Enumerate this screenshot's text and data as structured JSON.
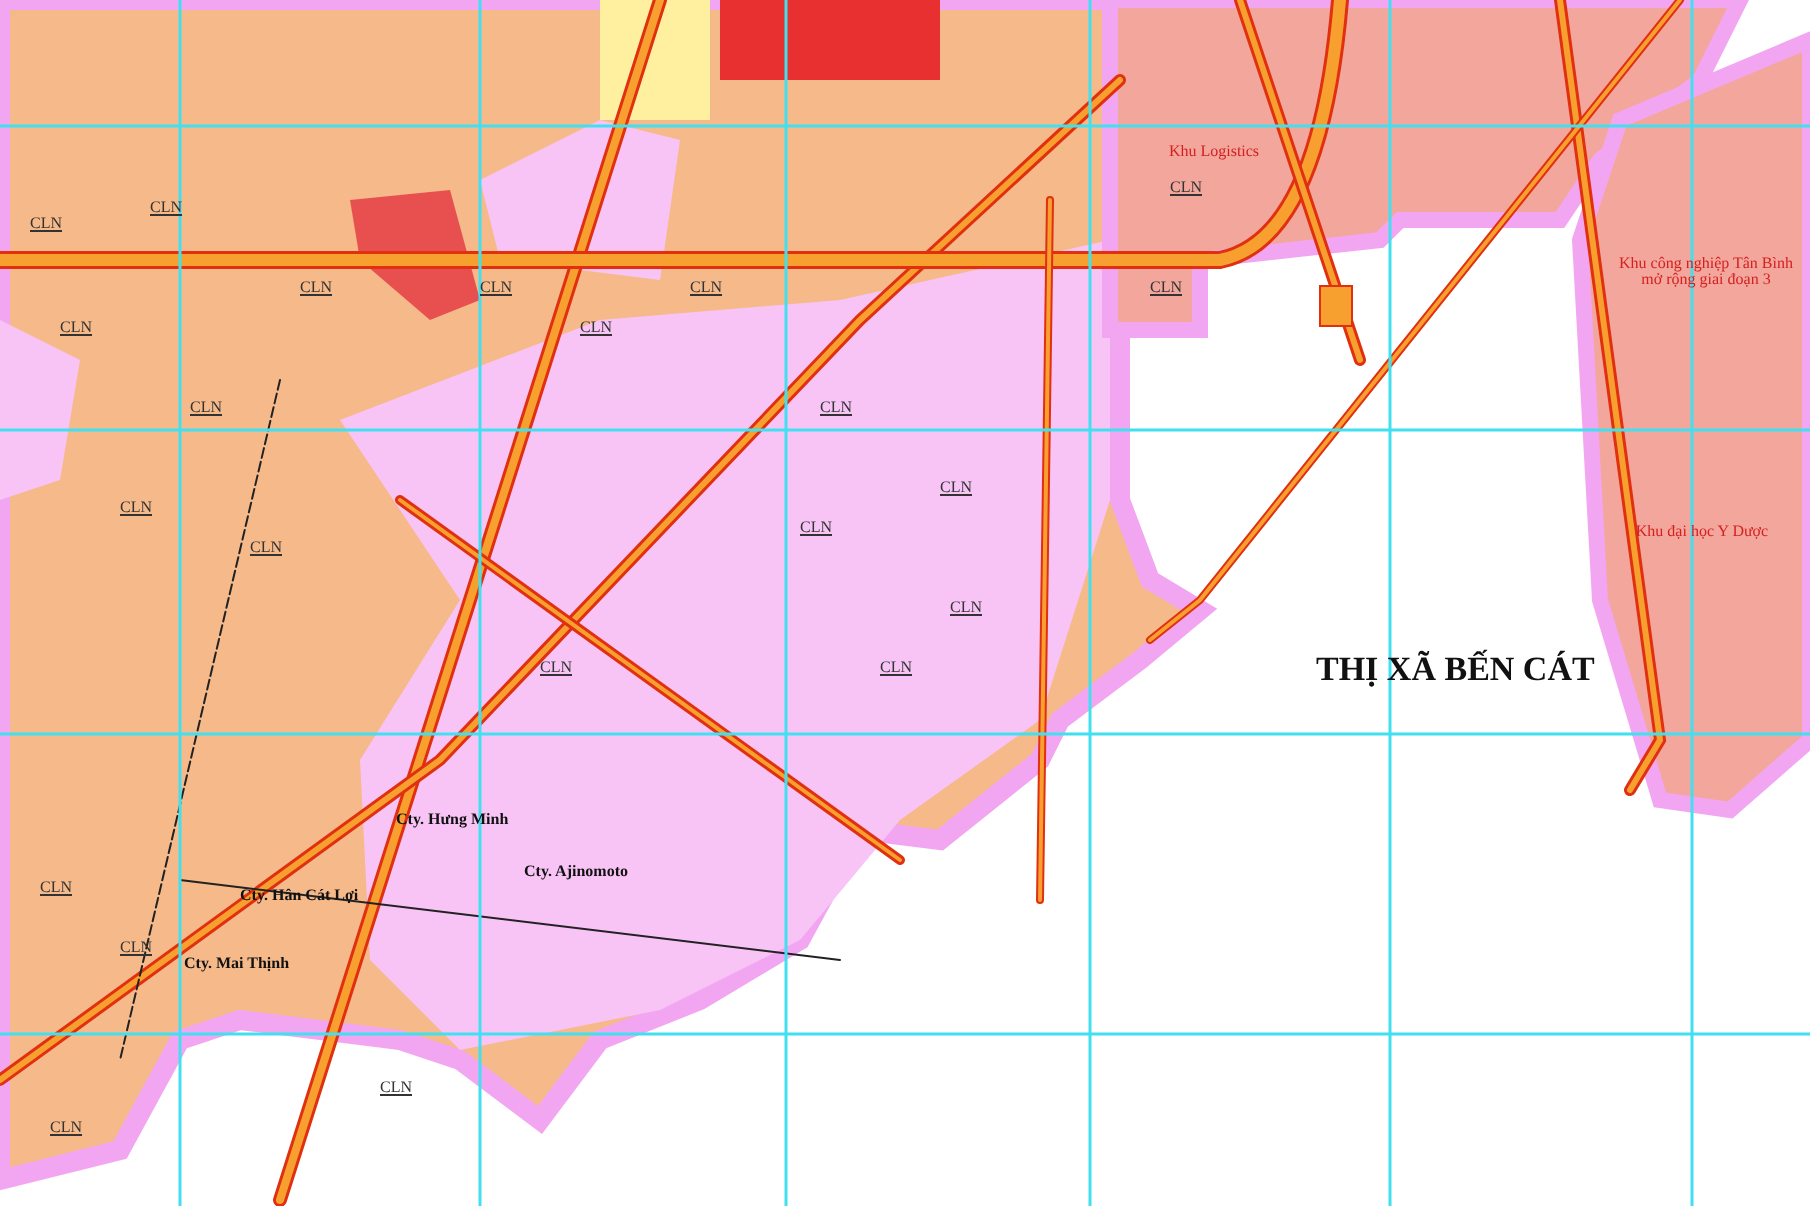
{
  "place_label": "THỊ XÃ BẾN CÁT",
  "area_labels": [
    {
      "text": "Khu Logistics",
      "kind": "zone"
    },
    {
      "text": "Khu công nghiệp Tân Bình mở rộng giai đoạn 3",
      "kind": "zone"
    },
    {
      "text": "Khu đại học Y Dược",
      "kind": "zone"
    },
    {
      "text": "Cty. Hưng Minh",
      "kind": "company"
    },
    {
      "text": "Cty. Ajinomoto",
      "kind": "company"
    },
    {
      "text": "Cty. Hân Cát Lợi",
      "kind": "company"
    },
    {
      "text": "Cty. Mai Thịnh",
      "kind": "company"
    }
  ],
  "land_codes": [
    "CLN",
    "CLN",
    "CLN",
    "CLN",
    "CLN",
    "CLN",
    "CLN",
    "CLN",
    "CLN",
    "CLN",
    "CLN",
    "CLN",
    "CLN",
    "CLN",
    "CLN",
    "CLN",
    "CLN",
    "CLN",
    "CLN",
    "CLN",
    "CLN",
    "CLN"
  ]
}
